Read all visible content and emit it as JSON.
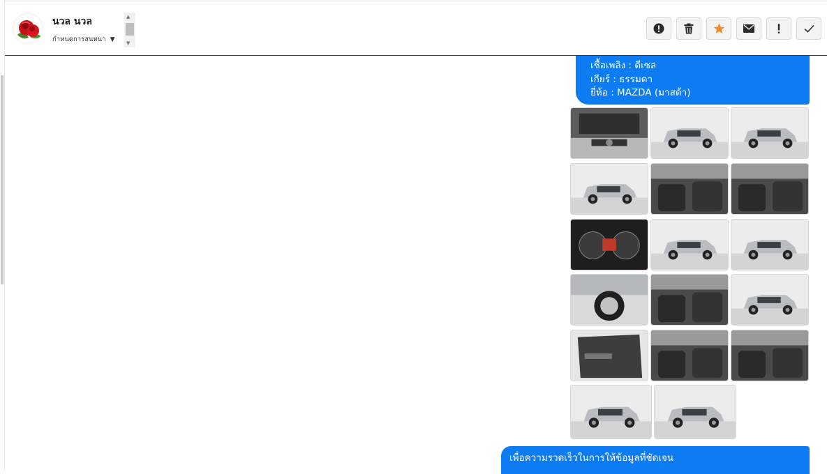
{
  "contact": {
    "name": "นวล นวล",
    "status_label": "กำหนดการสนทนา"
  },
  "toolbar": [
    {
      "name": "alert-button",
      "icon": "alert-circle-icon"
    },
    {
      "name": "delete-button",
      "icon": "trash-icon"
    },
    {
      "name": "star-button",
      "icon": "star-icon",
      "color": "#f08a24"
    },
    {
      "name": "mail-button",
      "icon": "envelope-icon"
    },
    {
      "name": "important-button",
      "icon": "exclamation-icon"
    },
    {
      "name": "done-button",
      "icon": "check-icon"
    }
  ],
  "messages": {
    "car_specs": {
      "fuel": "เชื้อเพลิง : ดีเซล",
      "gear": "เกียร์ : ธรรมดา",
      "brand": "ยี่ห้อ : MAZDA (มาสด้า)"
    },
    "photos": [
      {
        "subject": "engine-bay"
      },
      {
        "subject": "rear-view"
      },
      {
        "subject": "rear-three-quarter"
      },
      {
        "subject": "side-profile"
      },
      {
        "subject": "front-seats"
      },
      {
        "subject": "dashboard"
      },
      {
        "subject": "gauge-cluster"
      },
      {
        "subject": "front-three-quarter"
      },
      {
        "subject": "front-three-quarter-right"
      },
      {
        "subject": "wheel-close-up"
      },
      {
        "subject": "gear-shifter"
      },
      {
        "subject": "side-profile-far"
      },
      {
        "subject": "door-panel"
      },
      {
        "subject": "driver-interior"
      },
      {
        "subject": "seats-side"
      },
      {
        "subject": "front-view"
      },
      {
        "subject": "rear-view-open"
      }
    ],
    "followup": "เพื่อความรวดเร็วในการให้ข้อมูลที่ชัดเจน"
  },
  "colors": {
    "bubble": "#0d7cf2",
    "star": "#f08a24"
  }
}
